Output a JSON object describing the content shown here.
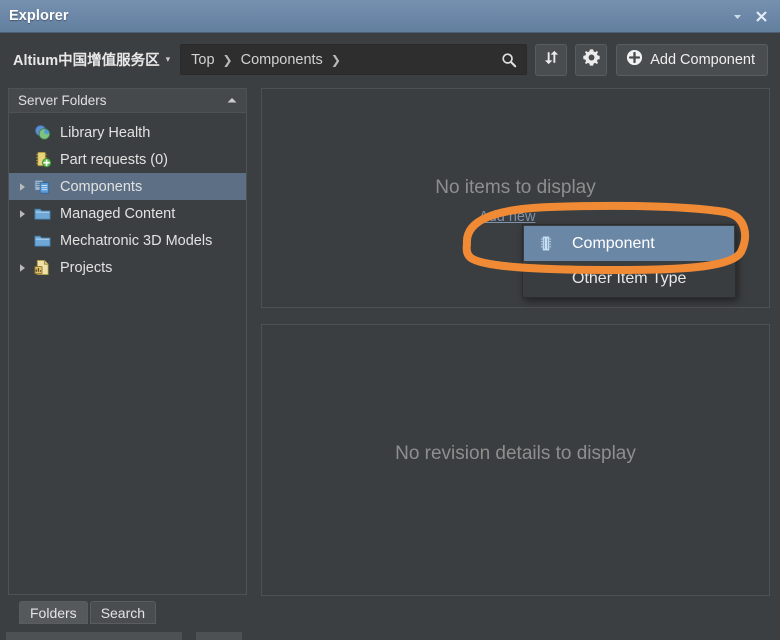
{
  "window": {
    "title": "Explorer",
    "collapse_icon": "chevron-down-icon",
    "close_icon": "close-icon"
  },
  "toolbar": {
    "vault_name": "Altium中国增值服务区",
    "vault_caret": "▾",
    "breadcrumb": [
      {
        "label": "Top"
      },
      {
        "label": "Components"
      }
    ],
    "breadcrumb_separator": "❯",
    "search_icon": "search-icon",
    "refresh_icon": "refresh-icon",
    "settings_icon": "gear-icon",
    "add_component_label": "Add Component",
    "add_component_icon": "plus-circle-icon"
  },
  "sidebar": {
    "header": "Server Folders",
    "collapse_icon": "chevron-up-icon",
    "items": [
      {
        "label": "Library Health",
        "icon": "library-health-icon",
        "expandable": false,
        "selected": false
      },
      {
        "label": "Part requests (0)",
        "icon": "part-request-icon",
        "expandable": false,
        "selected": false
      },
      {
        "label": "Components",
        "icon": "components-icon",
        "expandable": true,
        "selected": true
      },
      {
        "label": "Managed Content",
        "icon": "folder-icon",
        "expandable": true,
        "selected": false
      },
      {
        "label": "Mechatronic 3D Models",
        "icon": "folder-icon",
        "expandable": false,
        "selected": false
      },
      {
        "label": "Projects",
        "icon": "projects-icon",
        "expandable": true,
        "selected": false
      }
    ]
  },
  "tabs": [
    {
      "label": "Folders",
      "active": true
    },
    {
      "label": "Search",
      "active": false
    }
  ],
  "main": {
    "top_panel_empty_message": "No items to display",
    "bottom_panel_empty_message": "No revision details to display",
    "add_new_link": "Add new"
  },
  "context_menu": {
    "items": [
      {
        "label": "Component",
        "icon": "component-chip-icon",
        "highlighted": true
      },
      {
        "label": "Other Item Type",
        "icon": "",
        "highlighted": false
      }
    ]
  },
  "annotation": {
    "shape": "ellipse-highlight",
    "color": "#f08a35"
  },
  "colors": {
    "titlebar": "#6b86a6",
    "window_bg": "#3c3f41",
    "panel_bg": "#3b3e40",
    "selection_blue": "#5d6f84",
    "menu_highlight": "#6b87a6",
    "link_blue": "#7e93ab",
    "annotation_orange": "#f08a35",
    "muted_text": "#8e8e8e"
  }
}
